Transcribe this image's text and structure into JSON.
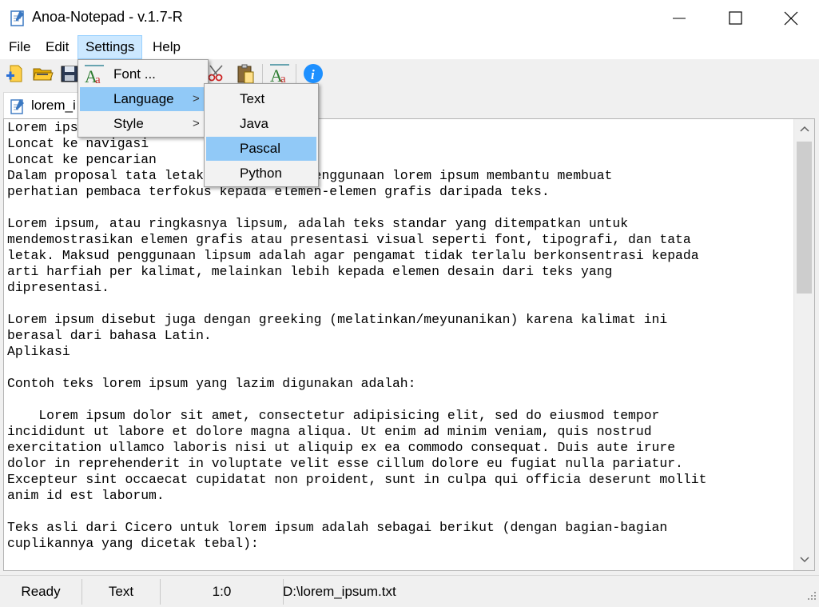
{
  "window": {
    "title": "Anoa-Notepad - v.1.7-R"
  },
  "menubar": {
    "items": [
      "File",
      "Edit",
      "Settings",
      "Help"
    ]
  },
  "tab": {
    "label": "lorem_i"
  },
  "settings_menu": {
    "items": [
      {
        "label": "Font ...",
        "has_submenu": false,
        "icon": "font-icon"
      },
      {
        "label": "Language",
        "has_submenu": true
      },
      {
        "label": "Style",
        "has_submenu": true
      }
    ],
    "submenu_arrow": ">"
  },
  "language_submenu": {
    "items": [
      "Text",
      "Java",
      "Pascal",
      "Python"
    ],
    "highlighted": "Pascal"
  },
  "editor": {
    "content": "Lorem ipsum \nLoncat ke navigasi\nLoncat ke pencarian\nDalam proposal tata letak desain ini, penggunaan lorem ipsum membantu membuat\nperhatian pembaca terfokus kepada elemen-elemen grafis daripada teks.\n\nLorem ipsum, atau ringkasnya lipsum, adalah teks standar yang ditempatkan untuk\nmendemostrasikan elemen grafis atau presentasi visual seperti font, tipografi, dan tata\nletak. Maksud penggunaan lipsum adalah agar pengamat tidak terlalu berkonsentrasi kepada\narti harfiah per kalimat, melainkan lebih kepada elemen desain dari teks yang\ndipresentasi.\n\nLorem ipsum disebut juga dengan greeking (melatinkan/meyunanikan) karena kalimat ini\nberasal dari bahasa Latin.\nAplikasi\n\nContoh teks lorem ipsum yang lazim digunakan adalah:\n\n    Lorem ipsum dolor sit amet, consectetur adipisicing elit, sed do eiusmod tempor\nincididunt ut labore et dolore magna aliqua. Ut enim ad minim veniam, quis nostrud\nexercitation ullamco laboris nisi ut aliquip ex ea commodo consequat. Duis aute irure\ndolor in reprehenderit in voluptate velit esse cillum dolore eu fugiat nulla pariatur.\nExcepteur sint occaecat cupidatat non proident, sunt in culpa qui officia deserunt mollit\nanim id est laborum.\n\nTeks asli dari Cicero untuk lorem ipsum adalah sebagai berikut (dengan bagian-bagian\ncuplikannya yang dicetak tebal):"
  },
  "statusbar": {
    "state": "Ready",
    "language": "Text",
    "position": "1:0",
    "path": "D:\\lorem_ipsum.txt"
  },
  "colors": {
    "menu_highlight": "#91c9f7",
    "menu_active": "#cce8ff"
  }
}
